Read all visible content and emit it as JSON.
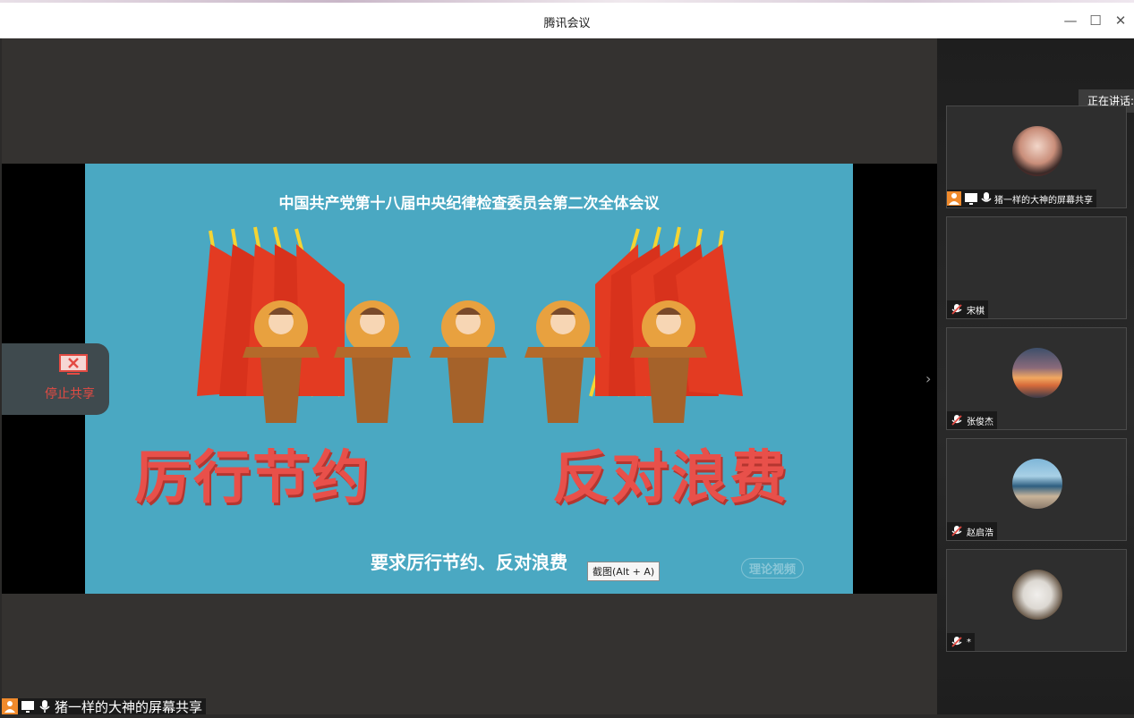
{
  "window": {
    "title": "腾讯会议",
    "minimize": "—",
    "maximize": "☐",
    "close": "✕"
  },
  "slide": {
    "top_text": "中国共产党第十八届中央纪律检查委员会第二次全体会议",
    "left_slogan": "厉行节约",
    "right_slogan": "反对浪费",
    "subtitle": "要求厉行节约、反对浪费",
    "watermark": "理论视频"
  },
  "tooltip": "截图(Alt + A)",
  "stop_share": {
    "label": "停止共享"
  },
  "speaking_label": "正在讲话:",
  "main_share_label": "猪一样的大神的屏幕共享",
  "participants": [
    {
      "name": "猪一样的大神的屏幕共享"
    },
    {
      "name": "宋棋"
    },
    {
      "name": "张俊杰"
    },
    {
      "name": "赵启浩"
    },
    {
      "name": "*"
    }
  ]
}
